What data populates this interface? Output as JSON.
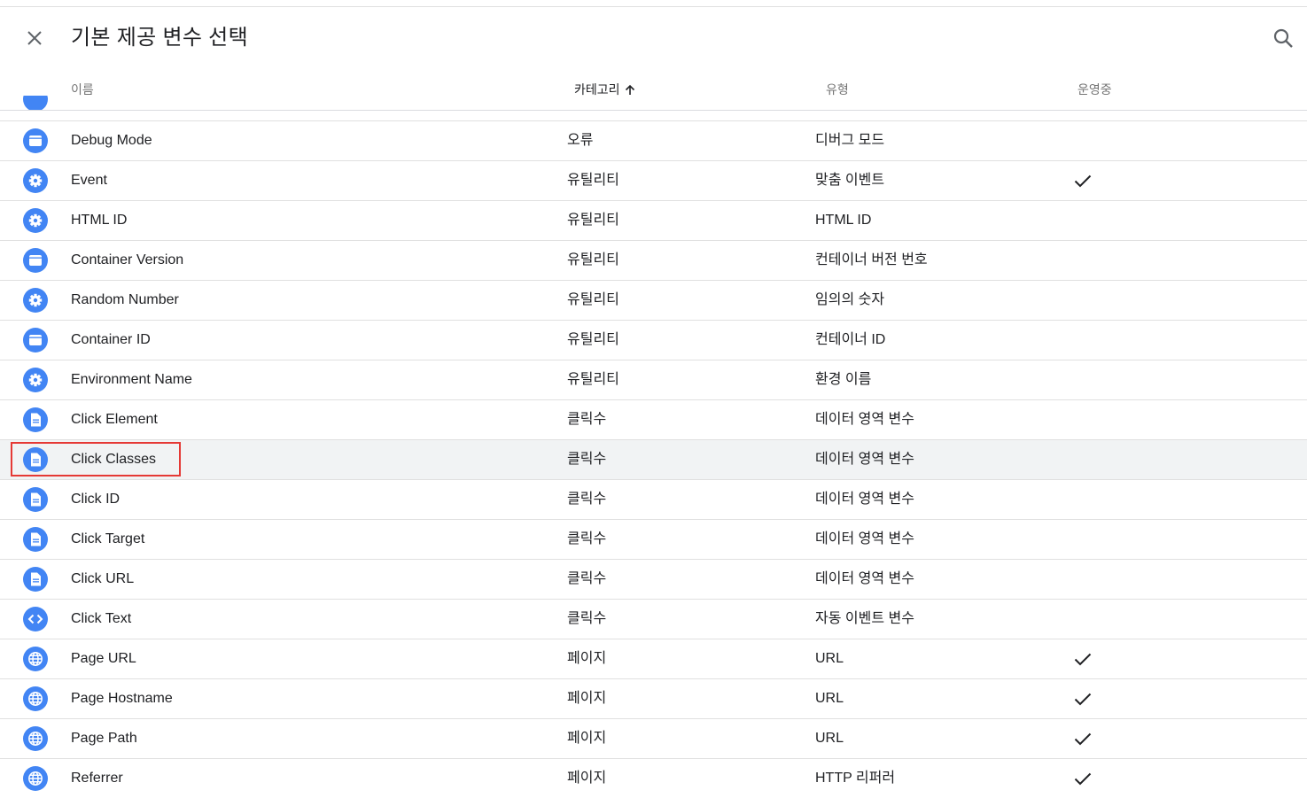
{
  "header": {
    "title": "기본 제공 변수 선택",
    "close_icon": "close-icon",
    "search_icon": "search-icon"
  },
  "columns": {
    "name": "이름",
    "category": "카테고리",
    "category_sort": "ascending",
    "type": "유형",
    "live": "운영중"
  },
  "colors": {
    "icon_blue": "#4285f4",
    "highlight_row": "#f1f3f4",
    "selection_border": "#e53935"
  },
  "rows": [
    {
      "name": "Debug Mode",
      "category": "오류",
      "type": "디버그 모드",
      "live": false,
      "icon": "container-icon"
    },
    {
      "name": "Event",
      "category": "유틸리티",
      "type": "맞춤 이벤트",
      "live": true,
      "icon": "gear-icon"
    },
    {
      "name": "HTML ID",
      "category": "유틸리티",
      "type": "HTML ID",
      "live": false,
      "icon": "gear-icon"
    },
    {
      "name": "Container Version",
      "category": "유틸리티",
      "type": "컨테이너 버전 번호",
      "live": false,
      "icon": "container-icon"
    },
    {
      "name": "Random Number",
      "category": "유틸리티",
      "type": "임의의 숫자",
      "live": false,
      "icon": "gear-icon"
    },
    {
      "name": "Container ID",
      "category": "유틸리티",
      "type": "컨테이너 ID",
      "live": false,
      "icon": "container-icon"
    },
    {
      "name": "Environment Name",
      "category": "유틸리티",
      "type": "환경 이름",
      "live": false,
      "icon": "gear-icon"
    },
    {
      "name": "Click Element",
      "category": "클릭수",
      "type": "데이터 영역 변수",
      "live": false,
      "icon": "document-icon"
    },
    {
      "name": "Click Classes",
      "category": "클릭수",
      "type": "데이터 영역 변수",
      "live": false,
      "icon": "document-icon",
      "selected": true
    },
    {
      "name": "Click ID",
      "category": "클릭수",
      "type": "데이터 영역 변수",
      "live": false,
      "icon": "document-icon"
    },
    {
      "name": "Click Target",
      "category": "클릭수",
      "type": "데이터 영역 변수",
      "live": false,
      "icon": "document-icon"
    },
    {
      "name": "Click URL",
      "category": "클릭수",
      "type": "데이터 영역 변수",
      "live": false,
      "icon": "document-icon"
    },
    {
      "name": "Click Text",
      "category": "클릭수",
      "type": "자동 이벤트 변수",
      "live": false,
      "icon": "code-icon"
    },
    {
      "name": "Page URL",
      "category": "페이지",
      "type": "URL",
      "live": true,
      "icon": "globe-icon"
    },
    {
      "name": "Page Hostname",
      "category": "페이지",
      "type": "URL",
      "live": true,
      "icon": "globe-icon"
    },
    {
      "name": "Page Path",
      "category": "페이지",
      "type": "URL",
      "live": true,
      "icon": "globe-icon"
    },
    {
      "name": "Referrer",
      "category": "페이지",
      "type": "HTTP 리퍼러",
      "live": true,
      "icon": "globe-icon"
    }
  ]
}
